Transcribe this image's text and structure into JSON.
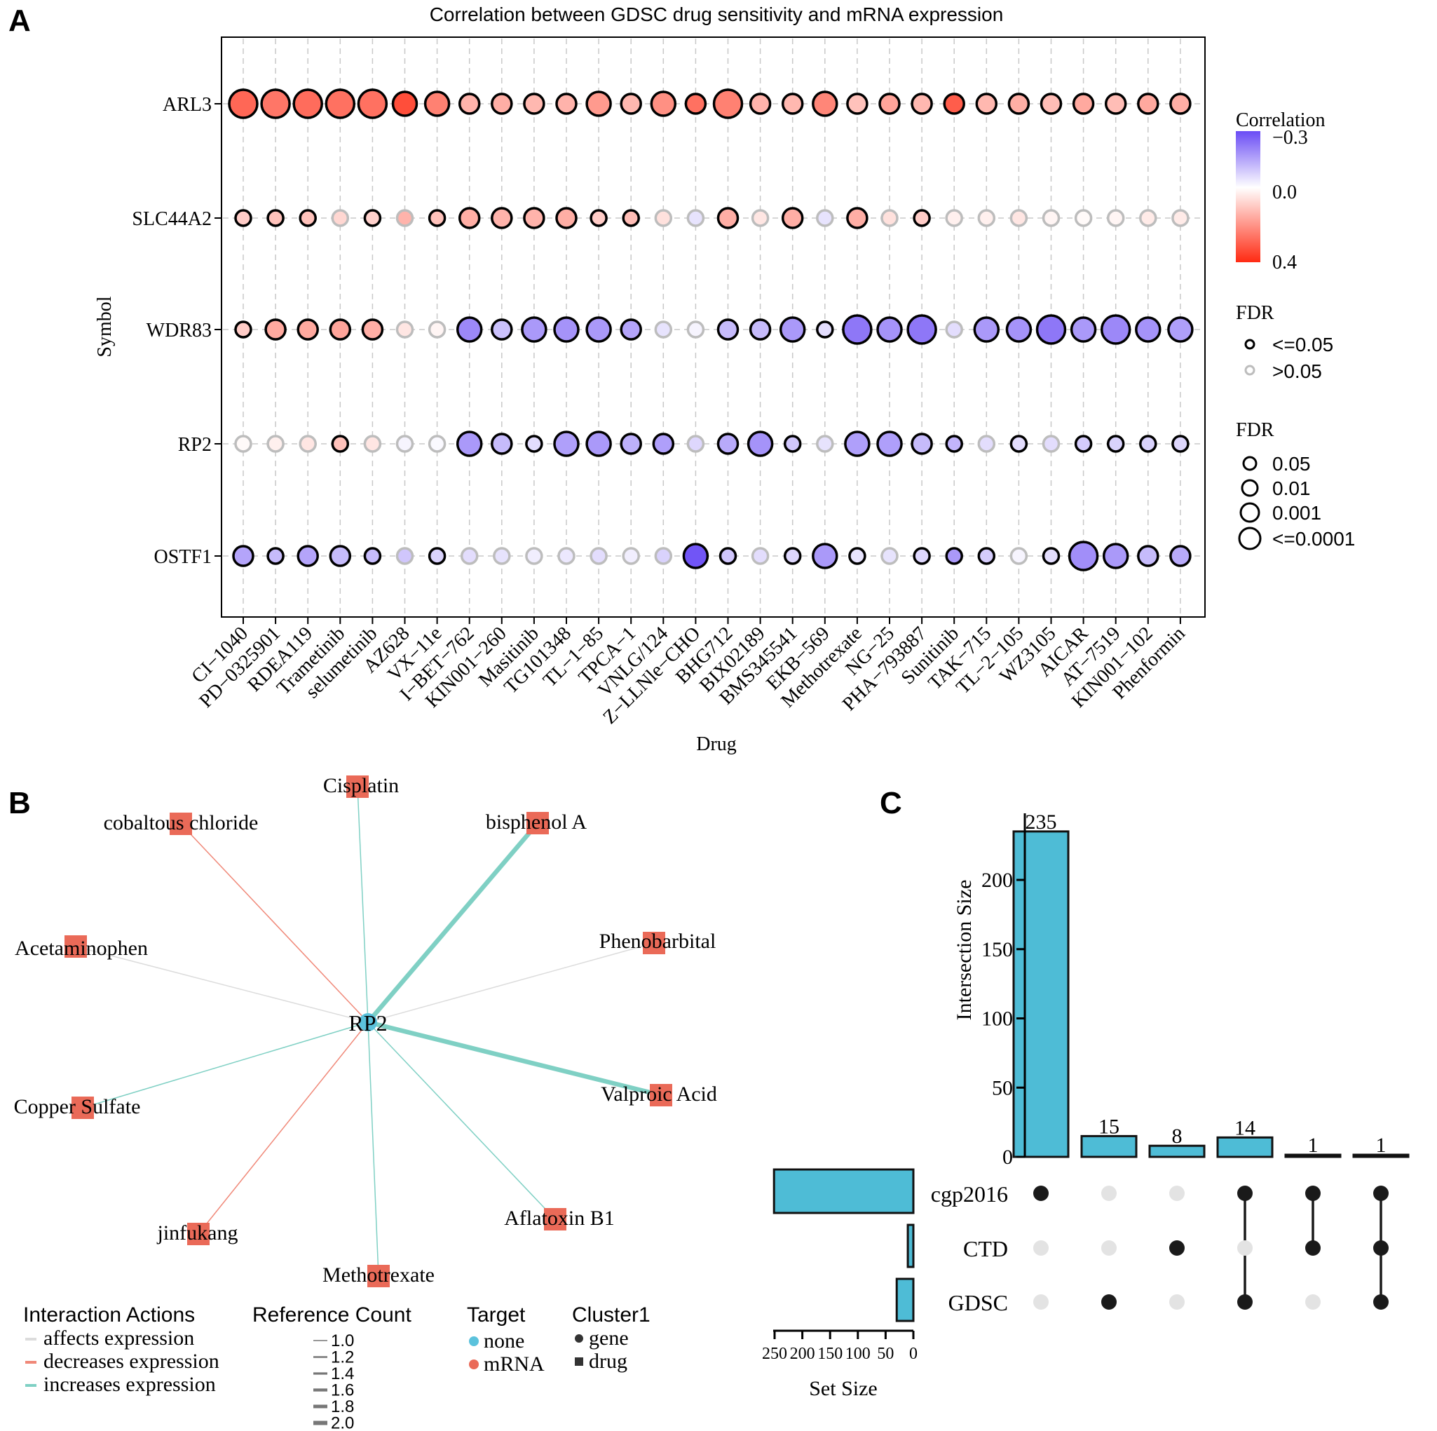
{
  "panels": {
    "A": "A",
    "B": "B",
    "C": "C"
  },
  "chart_data": [
    {
      "panel": "A",
      "type": "scatter",
      "subtype": "dot-matrix",
      "title": "Correlation between GDSC drug sensitivity and mRNA expression",
      "xlabel": "Drug",
      "ylabel": "Symbol",
      "grid": true,
      "x": [
        "CI−1040",
        "PD−0325901",
        "RDEA119",
        "Trametinib",
        "selumetinib",
        "AZ628",
        "VX−11e",
        "I−BET−762",
        "KIN001−260",
        "Masitinib",
        "TG101348",
        "TL−1−85",
        "TPCA−1",
        "VNLG/124",
        "Z−LLNle−CHO",
        "BHG712",
        "BIX02189",
        "BMS345541",
        "EKB−569",
        "Methotrexate",
        "NG−25",
        "PHA−793887",
        "Sunitinib",
        "TAK−715",
        "TL−2−105",
        "WZ3105",
        "AICAR",
        "AT−7519",
        "KIN001−102",
        "Phenformin"
      ],
      "y": [
        "ARL3",
        "SLC44A2",
        "WDR83",
        "RP2",
        "OSTF1"
      ],
      "color_legend": {
        "title": "Correlation",
        "ticks": [
          "−0.3",
          "0.0",
          "0.4"
        ],
        "range": [
          -0.3,
          0.4
        ],
        "low_color": "#6a4cf5",
        "mid_color": "#ffffff",
        "high_color": "#ff2a12"
      },
      "fdr_outline_legend": {
        "title": "FDR",
        "items": [
          {
            "label": "<=0.05",
            "color": "#000000"
          },
          {
            "label": ">0.05",
            "color": "#bdbdbd"
          }
        ]
      },
      "fdr_size_legend": {
        "title": "FDR",
        "items": [
          "0.05",
          "0.01",
          "0.001",
          "<=0.0001"
        ]
      },
      "series": [
        {
          "name": "ARL3",
          "correlation": [
            0.3,
            0.27,
            0.29,
            0.28,
            0.28,
            0.35,
            0.25,
            0.15,
            0.16,
            0.14,
            0.15,
            0.2,
            0.14,
            0.22,
            0.28,
            0.25,
            0.15,
            0.14,
            0.24,
            0.12,
            0.18,
            0.14,
            0.32,
            0.14,
            0.16,
            0.13,
            0.17,
            0.13,
            0.17,
            0.16
          ],
          "size_level": [
            4,
            4,
            4,
            4,
            4,
            3,
            3,
            2,
            2,
            2,
            2,
            3,
            2,
            3,
            2,
            4,
            2,
            2,
            3,
            2,
            2,
            2,
            2,
            2,
            2,
            2,
            2,
            2,
            2,
            2
          ],
          "significant": [
            true,
            true,
            true,
            true,
            true,
            true,
            true,
            true,
            true,
            true,
            true,
            true,
            true,
            true,
            true,
            true,
            true,
            true,
            true,
            true,
            true,
            true,
            true,
            true,
            true,
            true,
            true,
            true,
            true,
            true
          ]
        },
        {
          "name": "SLC44A2",
          "correlation": [
            0.1,
            0.12,
            0.12,
            0.08,
            0.09,
            0.15,
            0.12,
            0.16,
            0.15,
            0.15,
            0.16,
            0.1,
            0.13,
            0.06,
            -0.05,
            0.16,
            0.05,
            0.16,
            -0.05,
            0.16,
            0.06,
            0.1,
            0.03,
            0.03,
            0.05,
            0.02,
            0.01,
            0.02,
            0.04,
            0.04
          ],
          "size_level": [
            1,
            1,
            1,
            1,
            1,
            1,
            1,
            2,
            2,
            2,
            2,
            1,
            1,
            1,
            1,
            2,
            1,
            2,
            1,
            2,
            1,
            1,
            1,
            1,
            1,
            1,
            1,
            1,
            1,
            1
          ],
          "significant": [
            true,
            true,
            true,
            false,
            true,
            false,
            true,
            true,
            true,
            true,
            true,
            true,
            true,
            false,
            false,
            true,
            false,
            true,
            false,
            true,
            false,
            true,
            false,
            false,
            false,
            false,
            false,
            false,
            false,
            false
          ]
        },
        {
          "name": "WDR83",
          "correlation": [
            0.1,
            0.17,
            0.17,
            0.18,
            0.16,
            0.05,
            0.02,
            -0.21,
            -0.11,
            -0.18,
            -0.19,
            -0.18,
            -0.16,
            -0.05,
            -0.02,
            -0.12,
            -0.12,
            -0.18,
            -0.06,
            -0.24,
            -0.19,
            -0.24,
            -0.06,
            -0.18,
            -0.19,
            -0.24,
            -0.18,
            -0.21,
            -0.19,
            -0.17
          ],
          "size_level": [
            1,
            2,
            2,
            2,
            2,
            1,
            1,
            3,
            2,
            3,
            3,
            3,
            2,
            1,
            1,
            2,
            2,
            3,
            1,
            4,
            3,
            4,
            1,
            3,
            3,
            4,
            3,
            4,
            3,
            3
          ],
          "significant": [
            true,
            true,
            true,
            true,
            true,
            false,
            false,
            true,
            true,
            true,
            true,
            true,
            true,
            false,
            false,
            true,
            true,
            true,
            true,
            true,
            true,
            true,
            false,
            true,
            true,
            true,
            true,
            true,
            true,
            true
          ]
        },
        {
          "name": "RP2",
          "correlation": [
            0.01,
            0.03,
            0.05,
            0.12,
            0.05,
            -0.02,
            -0.01,
            -0.18,
            -0.12,
            -0.06,
            -0.17,
            -0.18,
            -0.14,
            -0.17,
            -0.07,
            -0.15,
            -0.19,
            -0.1,
            -0.05,
            -0.17,
            -0.17,
            -0.12,
            -0.13,
            -0.06,
            -0.06,
            -0.06,
            -0.09,
            -0.08,
            -0.08,
            -0.07
          ],
          "size_level": [
            1,
            1,
            1,
            1,
            1,
            1,
            1,
            3,
            2,
            1,
            3,
            3,
            2,
            2,
            1,
            2,
            3,
            1,
            1,
            3,
            3,
            2,
            1,
            1,
            1,
            1,
            1,
            1,
            1,
            1
          ],
          "significant": [
            false,
            false,
            false,
            true,
            false,
            false,
            false,
            true,
            true,
            true,
            true,
            true,
            true,
            true,
            false,
            true,
            true,
            true,
            false,
            true,
            true,
            true,
            true,
            false,
            true,
            false,
            true,
            true,
            true,
            true
          ]
        },
        {
          "name": "OSTF1",
          "correlation": [
            -0.16,
            -0.12,
            -0.16,
            -0.12,
            -0.12,
            -0.1,
            -0.08,
            -0.06,
            -0.05,
            -0.03,
            -0.04,
            -0.06,
            -0.03,
            -0.08,
            -0.3,
            -0.1,
            -0.06,
            -0.07,
            -0.18,
            -0.05,
            -0.05,
            -0.07,
            -0.18,
            -0.09,
            -0.02,
            -0.06,
            -0.2,
            -0.18,
            -0.12,
            -0.15
          ],
          "size_level": [
            2,
            1,
            2,
            2,
            1,
            1,
            1,
            1,
            1,
            1,
            1,
            1,
            1,
            1,
            3,
            1,
            1,
            1,
            3,
            1,
            1,
            1,
            1,
            1,
            1,
            1,
            4,
            3,
            2,
            2
          ],
          "significant": [
            true,
            true,
            true,
            true,
            true,
            false,
            true,
            false,
            false,
            false,
            false,
            false,
            false,
            false,
            true,
            true,
            false,
            true,
            true,
            true,
            false,
            true,
            true,
            true,
            false,
            true,
            true,
            true,
            true,
            true
          ]
        }
      ]
    },
    {
      "panel": "B",
      "type": "network",
      "center": {
        "label": "RP2",
        "target": "none",
        "cluster": "gene"
      },
      "nodes": [
        {
          "label": "Cisplatin",
          "action": "increases expression",
          "refs": 1.0
        },
        {
          "label": "bisphenol A",
          "action": "increases expression",
          "refs": 2.0
        },
        {
          "label": "Phenobarbital",
          "action": "affects expression",
          "refs": 1.0
        },
        {
          "label": "Valproic Acid",
          "action": "increases expression",
          "refs": 2.0
        },
        {
          "label": "Aflatoxin B1",
          "action": "increases expression",
          "refs": 1.0
        },
        {
          "label": "Methotrexate",
          "action": "increases expression",
          "refs": 1.0
        },
        {
          "label": "jinfukang",
          "action": "decreases expression",
          "refs": 1.0
        },
        {
          "label": "Copper Sulfate",
          "action": "increases expression",
          "refs": 1.0
        },
        {
          "label": "Acetaminophen",
          "action": "affects expression",
          "refs": 1.0
        },
        {
          "label": "cobaltous chloride",
          "action": "decreases expression",
          "refs": 1.0
        }
      ],
      "legend": {
        "interaction_actions": {
          "title": "Interaction Actions",
          "items": [
            {
              "label": "affects expression",
              "color": "#dcdcdc"
            },
            {
              "label": "decreases expression",
              "color": "#f08878"
            },
            {
              "label": "increases expression",
              "color": "#7fd0c4"
            }
          ]
        },
        "reference_count": {
          "title": "Reference Count",
          "items": [
            "1.0",
            "1.2",
            "1.4",
            "1.6",
            "1.8",
            "2.0"
          ]
        },
        "target": {
          "title": "Target",
          "items": [
            {
              "label": "none",
              "color": "#5bc2dc"
            },
            {
              "label": "mRNA",
              "color": "#ea6a58"
            }
          ]
        },
        "cluster": {
          "title": "Cluster1",
          "items": [
            {
              "label": "gene",
              "shape": "circle"
            },
            {
              "label": "drug",
              "shape": "square"
            }
          ]
        }
      },
      "colors": {
        "drug_node": "#ea6a58",
        "gene_node": "#5bc2dc"
      }
    },
    {
      "panel": "C",
      "type": "bar",
      "subtype": "upset",
      "ylabel": "Intersection Size",
      "ylim": [
        0,
        240
      ],
      "yticks": [
        "0",
        "50",
        "100",
        "150",
        "200"
      ],
      "values": [
        235,
        15,
        8,
        14,
        1,
        1
      ],
      "value_labels": [
        "235",
        "15",
        "8",
        "14",
        "1",
        "1"
      ],
      "sets": [
        "cgp2016",
        "CTD",
        "GDSC"
      ],
      "set_sizes": [
        251,
        10,
        30
      ],
      "set_size_label": "Set Size",
      "set_size_ticks": [
        "250",
        "200",
        "150",
        "100",
        "50",
        "0"
      ],
      "set_size_range": [
        0,
        250
      ],
      "membership": [
        [
          true,
          false,
          false
        ],
        [
          false,
          false,
          true
        ],
        [
          false,
          true,
          false
        ],
        [
          true,
          false,
          true
        ],
        [
          true,
          true,
          false
        ],
        [
          true,
          true,
          true
        ]
      ],
      "bar_color": "#4ebcd6"
    }
  ]
}
